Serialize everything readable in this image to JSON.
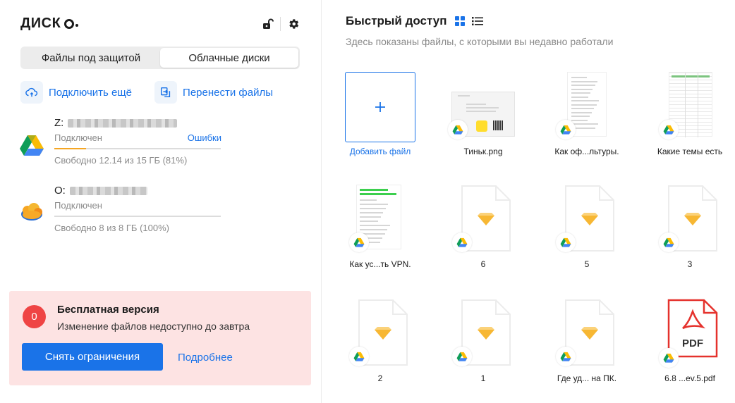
{
  "app": {
    "logo_text": "ДИСК",
    "icons": [
      "unlock-icon",
      "gear-icon"
    ]
  },
  "tabs": [
    {
      "label": "Файлы под защитой",
      "active": false
    },
    {
      "label": "Облачные диски",
      "active": true
    }
  ],
  "actions": {
    "connect_label": "Подключить ещё",
    "transfer_label": "Перенести файлы"
  },
  "disks": [
    {
      "letter": "Z:",
      "status": "Подключен",
      "error_link": "Ошибки",
      "free_text": "Свободно 12.14 из 15 ГБ (81%)",
      "used_fraction": 0.19,
      "bar_color": "#f5a623",
      "icon": "google-drive-icon"
    },
    {
      "letter": "O:",
      "status": "Подключен",
      "free_text": "Свободно 8 из 8 ГБ (100%)",
      "used_fraction": 0.0,
      "bar_color": "#dcdcdc",
      "icon": "cloud-icon"
    }
  ],
  "promo": {
    "badge": "0",
    "title": "Бесплатная версия",
    "text": "Изменение файлов недоступно до завтра",
    "button": "Снять ограничения",
    "link": "Подробнее"
  },
  "quick_access": {
    "title": "Быстрый доступ",
    "subtitle": "Здесь показаны файлы, с которыми вы недавно работали",
    "add_label": "Добавить файл",
    "files": [
      {
        "name": "Тиньк.png",
        "kind": "image"
      },
      {
        "name": "Как оф...льтуры.",
        "kind": "doc"
      },
      {
        "name": "Какие темы есть",
        "kind": "sheet"
      },
      {
        "name": "Как ус...ть VPN.",
        "kind": "doc-green"
      },
      {
        "name": "6",
        "kind": "sketch"
      },
      {
        "name": "5",
        "kind": "sketch"
      },
      {
        "name": "3",
        "kind": "sketch"
      },
      {
        "name": "2",
        "kind": "sketch"
      },
      {
        "name": "1",
        "kind": "sketch"
      },
      {
        "name": "Где уд... на ПК.",
        "kind": "sketch"
      },
      {
        "name": "6.8 ...ev.5.pdf",
        "kind": "pdf",
        "pdf_text": "PDF"
      }
    ]
  },
  "colors": {
    "accent": "#1a73e8",
    "promo_bg": "#fde3e3",
    "badge_red": "#ef4444",
    "sketch_orange": "#f7b733",
    "pdf_red": "#e5322d"
  }
}
